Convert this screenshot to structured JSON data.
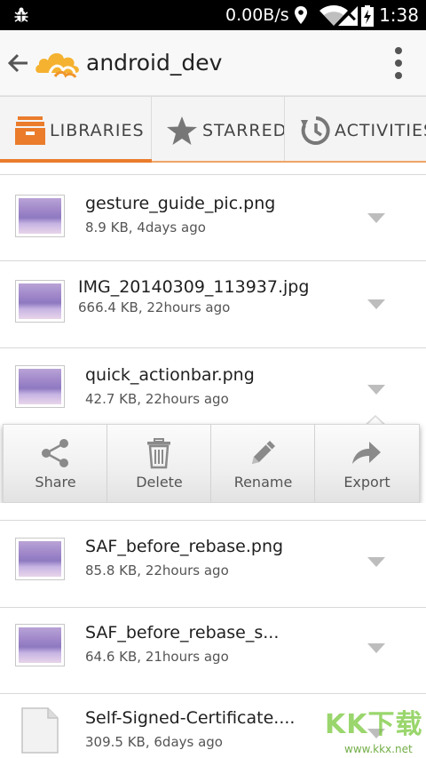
{
  "status_bar": {
    "network_speed": "0.00B/s",
    "time": "1:38",
    "icons": [
      "debug-bug-icon",
      "location-icon",
      "wifi-icon",
      "signal-icon",
      "battery-charging-icon"
    ]
  },
  "header": {
    "back_icon": "arrow-back-icon",
    "logo_icon": "seafile-cloud-logo",
    "title": "android_dev",
    "overflow_icon": "more-vertical-icon"
  },
  "tabs": [
    {
      "label": "LIBRARIES",
      "icon": "libraries-drawer-icon",
      "active": true
    },
    {
      "label": "STARRED",
      "icon": "star-icon",
      "active": false
    },
    {
      "label": "ACTIVITIES",
      "icon": "activity-history-icon",
      "active": false
    }
  ],
  "files": [
    {
      "name": "gesture_guide_pic.png",
      "meta": "8.9 KB, 4days ago",
      "type": "image"
    },
    {
      "name": "IMG_20140309_113937.jpg",
      "meta": "666.4 KB, 22hours ago",
      "type": "image"
    },
    {
      "name": "quick_actionbar.png",
      "meta": "42.7 KB, 22hours ago",
      "type": "image",
      "expanded": true
    },
    {
      "name": "SAF_before_rebase.png",
      "meta": "85.8 KB, 22hours ago",
      "type": "image"
    },
    {
      "name": "SAF_before_rebase_s...",
      "meta": "64.6 KB, 21hours ago",
      "type": "image"
    },
    {
      "name": "Self-Signed-Certificate....",
      "meta": "309.5 KB, 6days ago",
      "type": "document"
    }
  ],
  "file_actions": [
    {
      "label": "Share",
      "icon": "share-icon"
    },
    {
      "label": "Delete",
      "icon": "trash-icon"
    },
    {
      "label": "Rename",
      "icon": "pencil-icon"
    },
    {
      "label": "Export",
      "icon": "export-arrow-icon"
    }
  ],
  "watermark": {
    "text": "KK下载",
    "url_text": "www.kkx.net"
  },
  "colors": {
    "accent": "#ea7c2c",
    "status_bar": "#000000",
    "action_bar": "#f8f8f8"
  }
}
